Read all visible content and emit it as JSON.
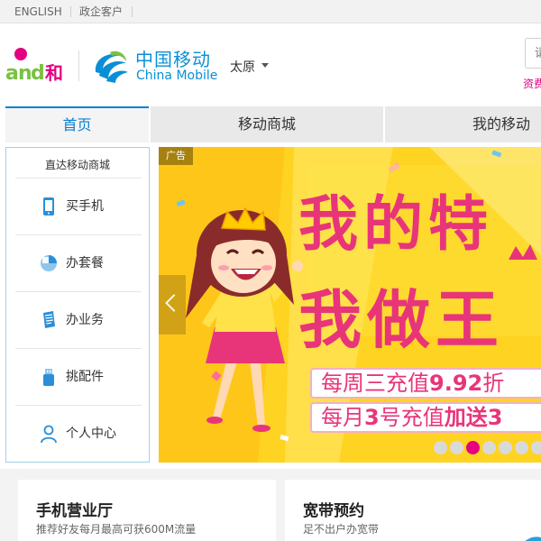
{
  "topbar": {
    "english": "ENGLISH",
    "gov": "政企客户"
  },
  "header": {
    "and_logo_text": "and和",
    "cm_cn": "中国移动",
    "cm_en": "China Mobile",
    "city": "太原",
    "search_placeholder": "请输入",
    "hot_link": "资费"
  },
  "nav": {
    "items": [
      {
        "label": "首页",
        "active": true
      },
      {
        "label": "移动商城",
        "active": false
      },
      {
        "label": "我的移动",
        "active": false
      }
    ]
  },
  "sidebar": {
    "title": "直达移动商城",
    "items": [
      {
        "label": "买手机",
        "icon": "phone-icon"
      },
      {
        "label": "办套餐",
        "icon": "package-icon"
      },
      {
        "label": "办业务",
        "icon": "document-icon"
      },
      {
        "label": "挑配件",
        "icon": "usb-icon"
      },
      {
        "label": "个人中心",
        "icon": "user-icon"
      }
    ]
  },
  "banner": {
    "ad_tag": "广告",
    "line1": "我的特",
    "line2": "我做王",
    "promo1_pre": "每周三充值",
    "promo1_hl": "9.92",
    "promo1_post": "折",
    "promo2_pre": "每月",
    "promo2_hl": "3",
    "promo2_mid": "号充值",
    "promo2_hl2": "加送3",
    "slide_count": 9,
    "active_slide": 3
  },
  "cards": [
    {
      "title": "手机营业厅",
      "subtitle": "推荐好友每月最高可获600M流量"
    },
    {
      "title": "宽带预约",
      "subtitle": "足不出户办宽带"
    }
  ],
  "colors": {
    "brand_blue": "#0a8fd6",
    "brand_pink": "#e4007f",
    "banner_yellow": "#ffd321"
  }
}
